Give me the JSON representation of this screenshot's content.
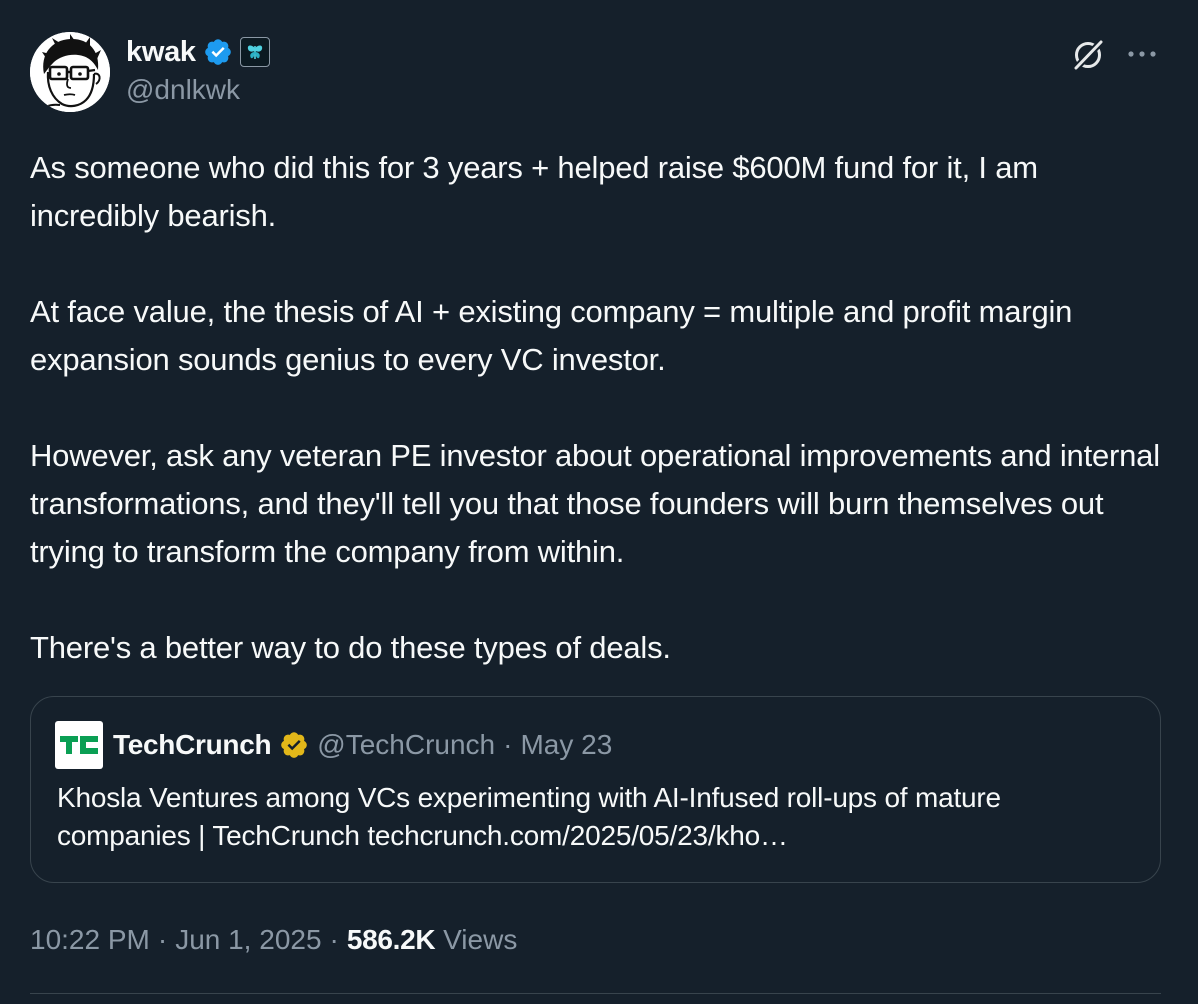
{
  "author": {
    "name": "kwak",
    "handle": "@dnlkwk",
    "verified": true,
    "verified_color": "#1d9bf0"
  },
  "header_icons": [
    "grok-icon",
    "more-icon"
  ],
  "tweet": {
    "paragraphs": [
      "As someone who did this for 3 years + helped raise $600M fund for it, I am incredibly bearish.",
      "At face value, the thesis of AI + existing company = multiple and profit margin expansion sounds genius to every VC investor.",
      "However, ask any veteran PE investor about operational improvements and internal transformations, and they'll tell you that those founders will burn themselves out trying to transform the company from within.",
      "There's a better way to do these types of deals."
    ]
  },
  "quote": {
    "author": "TechCrunch",
    "handle": "@TechCrunch",
    "separator": "·",
    "date": "May 23",
    "verified_color": "#e2b719",
    "logo_color": "#0a9f54",
    "text": "Khosla Ventures among VCs experimenting with AI-Infused roll-ups of mature companies | TechCrunch techcrunch.com/2025/05/23/kho…"
  },
  "meta": {
    "time": "10:22 PM",
    "sep1": "·",
    "date": "Jun 1, 2025",
    "sep2": "·",
    "views_count": "586.2K",
    "views_label": "Views"
  },
  "colors": {
    "background": "#15202b",
    "text_primary": "#f7f9f9",
    "text_secondary": "#8b98a5",
    "border": "#38444d"
  }
}
